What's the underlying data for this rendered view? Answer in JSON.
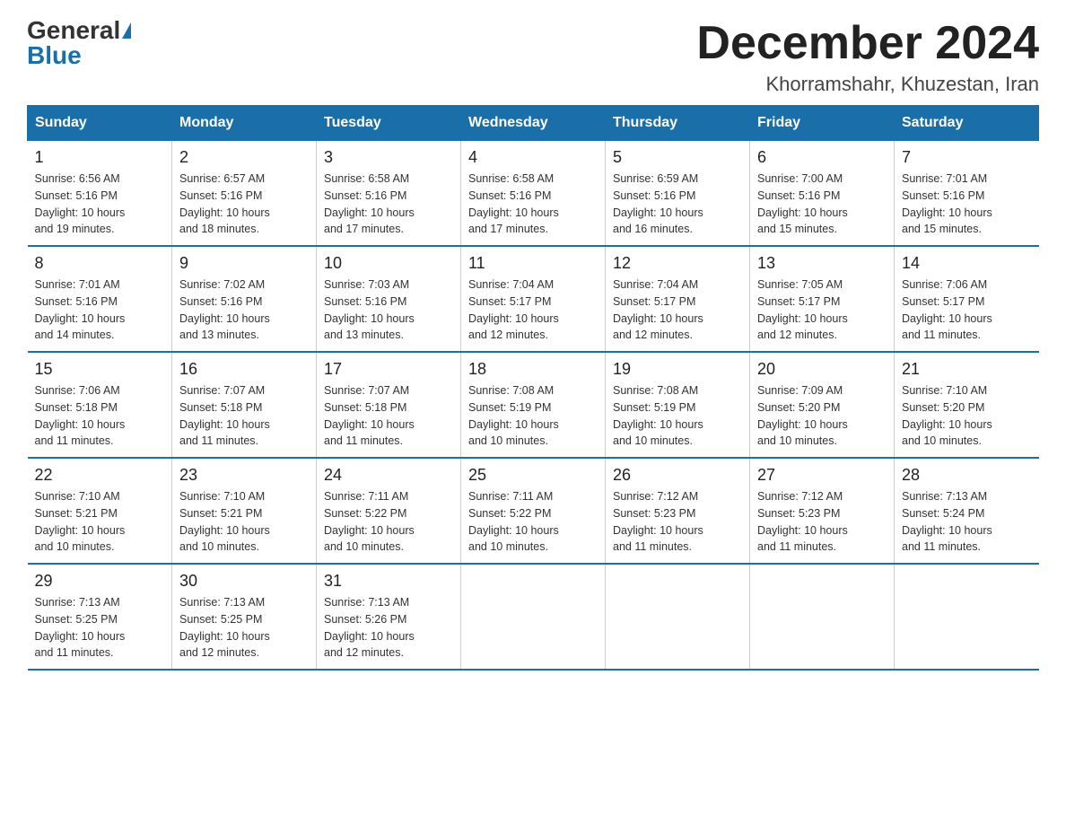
{
  "logo": {
    "general": "General",
    "blue": "Blue"
  },
  "title": "December 2024",
  "subtitle": "Khorramshahr, Khuzestan, Iran",
  "headers": [
    "Sunday",
    "Monday",
    "Tuesday",
    "Wednesday",
    "Thursday",
    "Friday",
    "Saturday"
  ],
  "weeks": [
    [
      {
        "day": "1",
        "sunrise": "6:56 AM",
        "sunset": "5:16 PM",
        "daylight": "10 hours and 19 minutes."
      },
      {
        "day": "2",
        "sunrise": "6:57 AM",
        "sunset": "5:16 PM",
        "daylight": "10 hours and 18 minutes."
      },
      {
        "day": "3",
        "sunrise": "6:58 AM",
        "sunset": "5:16 PM",
        "daylight": "10 hours and 17 minutes."
      },
      {
        "day": "4",
        "sunrise": "6:58 AM",
        "sunset": "5:16 PM",
        "daylight": "10 hours and 17 minutes."
      },
      {
        "day": "5",
        "sunrise": "6:59 AM",
        "sunset": "5:16 PM",
        "daylight": "10 hours and 16 minutes."
      },
      {
        "day": "6",
        "sunrise": "7:00 AM",
        "sunset": "5:16 PM",
        "daylight": "10 hours and 15 minutes."
      },
      {
        "day": "7",
        "sunrise": "7:01 AM",
        "sunset": "5:16 PM",
        "daylight": "10 hours and 15 minutes."
      }
    ],
    [
      {
        "day": "8",
        "sunrise": "7:01 AM",
        "sunset": "5:16 PM",
        "daylight": "10 hours and 14 minutes."
      },
      {
        "day": "9",
        "sunrise": "7:02 AM",
        "sunset": "5:16 PM",
        "daylight": "10 hours and 13 minutes."
      },
      {
        "day": "10",
        "sunrise": "7:03 AM",
        "sunset": "5:16 PM",
        "daylight": "10 hours and 13 minutes."
      },
      {
        "day": "11",
        "sunrise": "7:04 AM",
        "sunset": "5:17 PM",
        "daylight": "10 hours and 12 minutes."
      },
      {
        "day": "12",
        "sunrise": "7:04 AM",
        "sunset": "5:17 PM",
        "daylight": "10 hours and 12 minutes."
      },
      {
        "day": "13",
        "sunrise": "7:05 AM",
        "sunset": "5:17 PM",
        "daylight": "10 hours and 12 minutes."
      },
      {
        "day": "14",
        "sunrise": "7:06 AM",
        "sunset": "5:17 PM",
        "daylight": "10 hours and 11 minutes."
      }
    ],
    [
      {
        "day": "15",
        "sunrise": "7:06 AM",
        "sunset": "5:18 PM",
        "daylight": "10 hours and 11 minutes."
      },
      {
        "day": "16",
        "sunrise": "7:07 AM",
        "sunset": "5:18 PM",
        "daylight": "10 hours and 11 minutes."
      },
      {
        "day": "17",
        "sunrise": "7:07 AM",
        "sunset": "5:18 PM",
        "daylight": "10 hours and 11 minutes."
      },
      {
        "day": "18",
        "sunrise": "7:08 AM",
        "sunset": "5:19 PM",
        "daylight": "10 hours and 10 minutes."
      },
      {
        "day": "19",
        "sunrise": "7:08 AM",
        "sunset": "5:19 PM",
        "daylight": "10 hours and 10 minutes."
      },
      {
        "day": "20",
        "sunrise": "7:09 AM",
        "sunset": "5:20 PM",
        "daylight": "10 hours and 10 minutes."
      },
      {
        "day": "21",
        "sunrise": "7:10 AM",
        "sunset": "5:20 PM",
        "daylight": "10 hours and 10 minutes."
      }
    ],
    [
      {
        "day": "22",
        "sunrise": "7:10 AM",
        "sunset": "5:21 PM",
        "daylight": "10 hours and 10 minutes."
      },
      {
        "day": "23",
        "sunrise": "7:10 AM",
        "sunset": "5:21 PM",
        "daylight": "10 hours and 10 minutes."
      },
      {
        "day": "24",
        "sunrise": "7:11 AM",
        "sunset": "5:22 PM",
        "daylight": "10 hours and 10 minutes."
      },
      {
        "day": "25",
        "sunrise": "7:11 AM",
        "sunset": "5:22 PM",
        "daylight": "10 hours and 10 minutes."
      },
      {
        "day": "26",
        "sunrise": "7:12 AM",
        "sunset": "5:23 PM",
        "daylight": "10 hours and 11 minutes."
      },
      {
        "day": "27",
        "sunrise": "7:12 AM",
        "sunset": "5:23 PM",
        "daylight": "10 hours and 11 minutes."
      },
      {
        "day": "28",
        "sunrise": "7:13 AM",
        "sunset": "5:24 PM",
        "daylight": "10 hours and 11 minutes."
      }
    ],
    [
      {
        "day": "29",
        "sunrise": "7:13 AM",
        "sunset": "5:25 PM",
        "daylight": "10 hours and 11 minutes."
      },
      {
        "day": "30",
        "sunrise": "7:13 AM",
        "sunset": "5:25 PM",
        "daylight": "10 hours and 12 minutes."
      },
      {
        "day": "31",
        "sunrise": "7:13 AM",
        "sunset": "5:26 PM",
        "daylight": "10 hours and 12 minutes."
      },
      null,
      null,
      null,
      null
    ]
  ]
}
